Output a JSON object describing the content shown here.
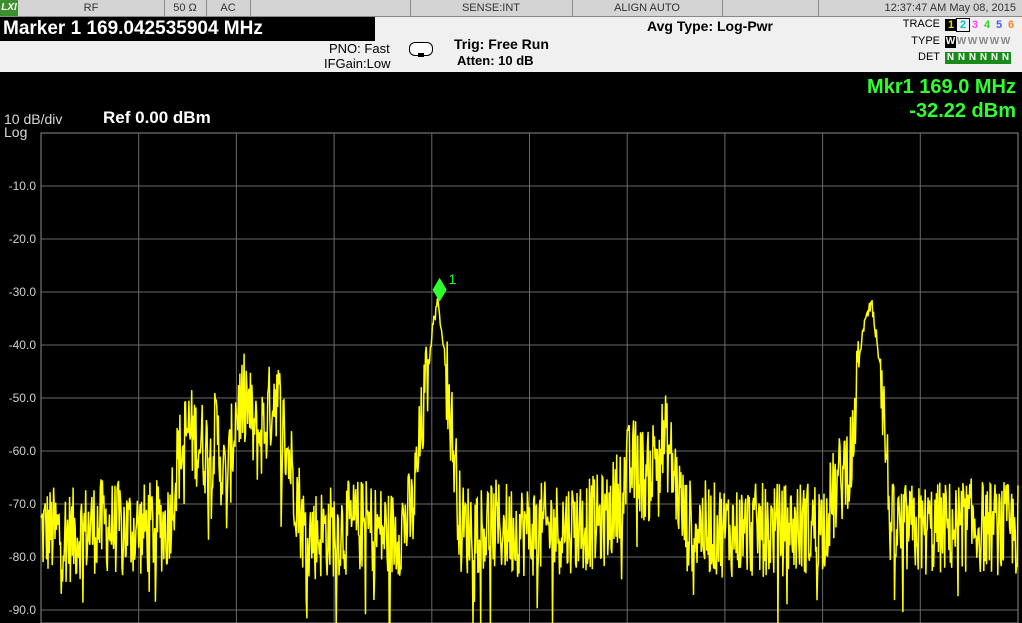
{
  "status_bar": {
    "logo": "LXI",
    "rf": "RF",
    "impedance": "50 Ω",
    "coupling": "AC",
    "sense": "SENSE:INT",
    "align": "ALIGN AUTO",
    "datetime": "12:37:47 AM May 08, 2015"
  },
  "header": {
    "marker_title": "Marker 1 169.042535904 MHz",
    "pno": "PNO: Fast",
    "ifgain": "IFGain:Low",
    "trig": "Trig: Free Run",
    "atten": "Atten: 10 dB",
    "avg_type": "Avg Type: Log-Pwr"
  },
  "trace_panel": {
    "trace_label": "TRACE",
    "type_label": "TYPE",
    "det_label": "DET",
    "traces": [
      "1",
      "2",
      "3",
      "4",
      "5",
      "6"
    ],
    "trace_colors": [
      "#e0e000",
      "#00c0e0",
      "#ff40ff",
      "#30d030",
      "#4060ff",
      "#ff8020"
    ],
    "types": "WWWWWW",
    "dets": "NNNNNN"
  },
  "marker_readout": {
    "frequency": "Mkr1 169.0 MHz",
    "level": "-32.22 dBm",
    "marker_label": "1"
  },
  "display": {
    "scale": "10 dB/div",
    "scale_type": "Log",
    "ref_level": "Ref 0.00 dBm"
  },
  "chart_data": {
    "type": "line",
    "ylabel_ticks": [
      "-10.0",
      "-20.0",
      "-30.0",
      "-40.0",
      "-50.0",
      "-60.0",
      "-70.0",
      "-80.0",
      "-90.0"
    ],
    "ylim": [
      -90,
      0
    ],
    "grid": true,
    "trace_color": "#ffff00",
    "marker_color": "#30ff30",
    "marker": {
      "x_fraction_of_span": 0.408,
      "y": -32.22
    },
    "series": [
      {
        "x": [
          0.0,
          0.03,
          0.06,
          0.1,
          0.13,
          0.14,
          0.15,
          0.16,
          0.17,
          0.18,
          0.19,
          0.2,
          0.21,
          0.22,
          0.23,
          0.24,
          0.25,
          0.26,
          0.27,
          0.3,
          0.33,
          0.36,
          0.38,
          0.39,
          0.4,
          0.405,
          0.41,
          0.42,
          0.43,
          0.45,
          0.5,
          0.55,
          0.58,
          0.6,
          0.61,
          0.62,
          0.63,
          0.64,
          0.65,
          0.66,
          0.7,
          0.75,
          0.8,
          0.83,
          0.84,
          0.85,
          0.86,
          0.87,
          0.9,
          0.95,
          1.0
        ],
        "y": [
          -75,
          -76,
          -74,
          -75,
          -74,
          -62,
          -56,
          -58,
          -60,
          -57,
          -68,
          -52,
          -50,
          -58,
          -55,
          -48,
          -58,
          -66,
          -76,
          -75,
          -74,
          -76,
          -72,
          -55,
          -38,
          -32,
          -36,
          -55,
          -75,
          -74,
          -75,
          -74,
          -73,
          -64,
          -62,
          -66,
          -60,
          -58,
          -66,
          -74,
          -75,
          -75,
          -74,
          -60,
          -38,
          -32,
          -45,
          -75,
          -75,
          -74,
          -75
        ]
      }
    ]
  }
}
